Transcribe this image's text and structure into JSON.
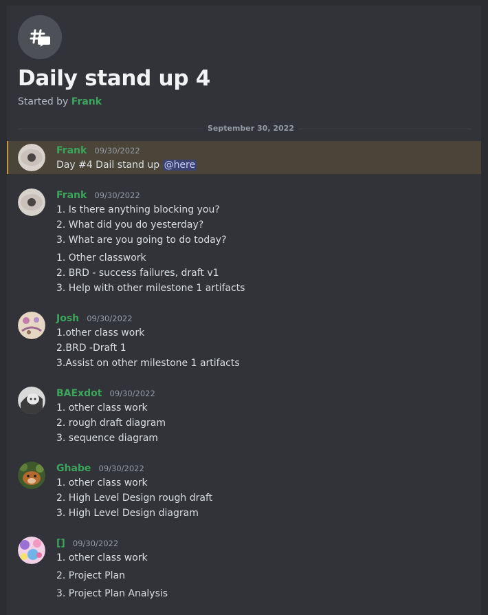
{
  "thread": {
    "title": "Daily stand up 4",
    "started_prefix": "Started by",
    "started_by": "Frank"
  },
  "date_divider": "September 30, 2022",
  "messages": [
    {
      "author": "Frank",
      "timestamp": "09/30/2022",
      "text": "Day #4 Dail stand up",
      "mention": "@here"
    },
    {
      "author": "Frank",
      "timestamp": "09/30/2022",
      "lines": [
        "1. Is there anything blocking you?",
        "2. What did you do yesterday?",
        "3. What are you going to do today?",
        "1. Other classwork",
        "2. BRD - success failures, draft v1",
        "3. Help with other milestone 1 artifacts"
      ]
    },
    {
      "author": "Josh",
      "timestamp": "09/30/2022",
      "lines": [
        "1.other class work",
        "2.BRD -Draft 1",
        "3.Assist on other milestone 1 artifacts"
      ]
    },
    {
      "author": "BAExdot",
      "timestamp": "09/30/2022",
      "lines": [
        "1. other class work",
        "2. rough draft diagram",
        "3. sequence diagram"
      ]
    },
    {
      "author": "Ghabe",
      "timestamp": "09/30/2022",
      "lines": [
        "1. other class work",
        "2. High Level Design rough draft",
        "3. High Level Design diagram"
      ]
    },
    {
      "author": "[]",
      "timestamp": "09/30/2022",
      "lines": [
        "1. other class work",
        "2. Project Plan",
        "3. Project Plan Analysis"
      ]
    }
  ],
  "icons": {
    "thread": "thread-icon",
    "mention_color": "#c9cdfb",
    "author_color": "#3ba55c",
    "highlight_color": "#4a4439"
  }
}
